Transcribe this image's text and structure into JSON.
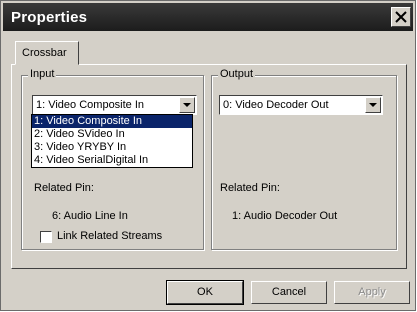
{
  "window": {
    "title": "Properties"
  },
  "tabs": [
    {
      "label": "Crossbar"
    }
  ],
  "input": {
    "group_label": "Input",
    "selected_value": "1: Video Composite In",
    "options": [
      "1: Video Composite In",
      "2: Video SVideo In",
      "3: Video YRYBY In",
      "4: Video SerialDigital In"
    ],
    "related_pin_label": "Related Pin:",
    "related_pin_value": "6: Audio Line In",
    "link_checkbox_label": "Link Related Streams",
    "link_checked": false
  },
  "output": {
    "group_label": "Output",
    "selected_value": "0: Video Decoder Out",
    "related_pin_label": "Related Pin:",
    "related_pin_value": "1: Audio Decoder Out"
  },
  "buttons": {
    "ok": "OK",
    "cancel": "Cancel",
    "apply": "Apply"
  },
  "icons": {
    "close": "close-icon",
    "dropdown": "chevron-down-icon"
  },
  "colors": {
    "titlebar": "#1c1c1c",
    "face": "#d4d0c8",
    "selection": "#0a246a"
  }
}
